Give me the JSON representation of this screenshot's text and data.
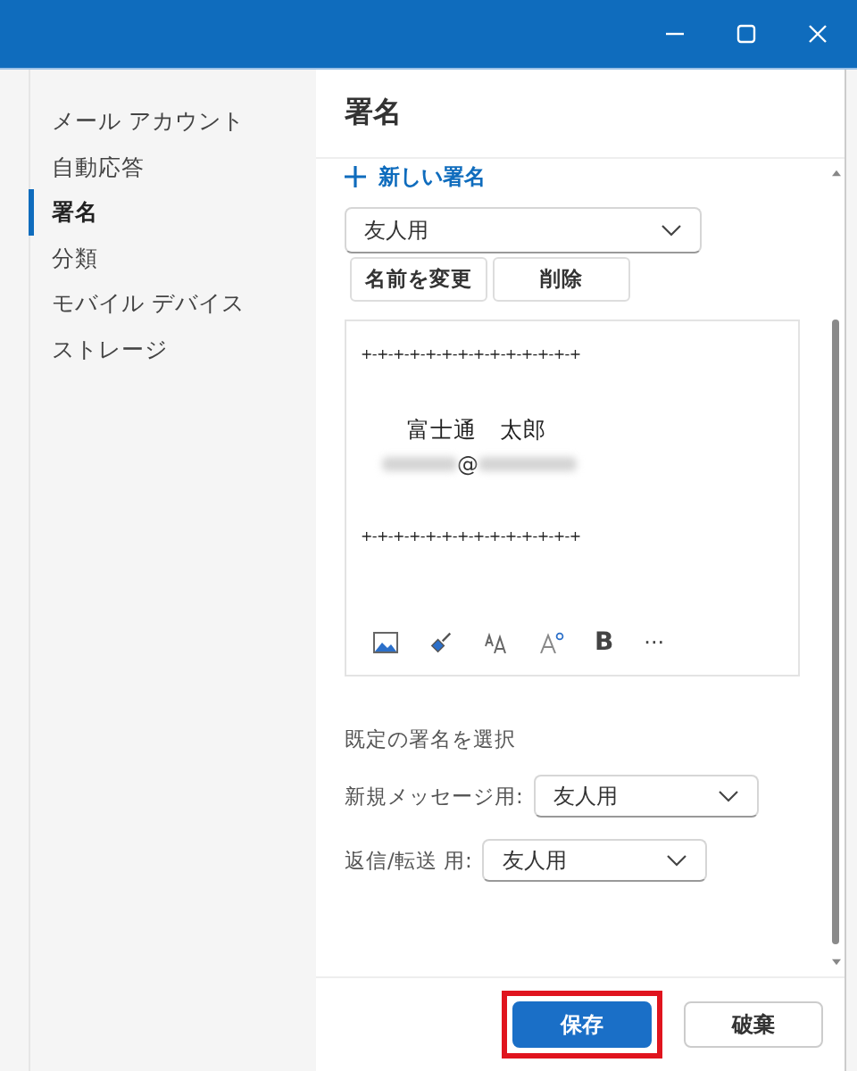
{
  "window": {
    "controls": [
      {
        "kind": "minimize"
      },
      {
        "kind": "maximize"
      },
      {
        "kind": "close"
      }
    ]
  },
  "sidebar": {
    "items": [
      {
        "label": "メール アカウント",
        "selected": false
      },
      {
        "label": "自動応答",
        "selected": false
      },
      {
        "label": "署名",
        "selected": true
      },
      {
        "label": "分類",
        "selected": false
      },
      {
        "label": "モバイル デバイス",
        "selected": false
      },
      {
        "label": "ストレージ",
        "selected": false
      }
    ]
  },
  "page": {
    "title": "署名",
    "new_signature": "新しい署名",
    "signature_select": {
      "value": "友人用"
    },
    "actions": [
      "名前を変更",
      "削除"
    ],
    "editor": {
      "lines": [
        {
          "kind": "text",
          "text": "+-+-+-+-+-+-+-+-+-+-+-+-+-+"
        },
        {
          "kind": "blank"
        },
        {
          "kind": "indent",
          "text": "富士通　太郎"
        },
        {
          "kind": "redacted",
          "text": "@"
        },
        {
          "kind": "blank"
        },
        {
          "kind": "text",
          "text": "+-+-+-+-+-+-+-+-+-+-+-+-+-+"
        }
      ],
      "toolbar": [
        {
          "kind": "image"
        },
        {
          "kind": "brush"
        },
        {
          "kind": "size"
        },
        {
          "kind": "super"
        },
        {
          "kind": "bold",
          "text": "B"
        },
        {
          "kind": "more",
          "text": "···"
        }
      ]
    },
    "defaults_heading": "既定の署名を選択",
    "defaults": [
      {
        "label": "新規メッセージ用:",
        "value": "友人用"
      },
      {
        "label": "返信/転送 用:",
        "value": "友人用"
      }
    ]
  },
  "footer": {
    "buttons": [
      {
        "label": "保存",
        "kind": "primary",
        "highlighted": true
      },
      {
        "label": "破棄",
        "kind": "secondary",
        "highlighted": false
      }
    ]
  }
}
